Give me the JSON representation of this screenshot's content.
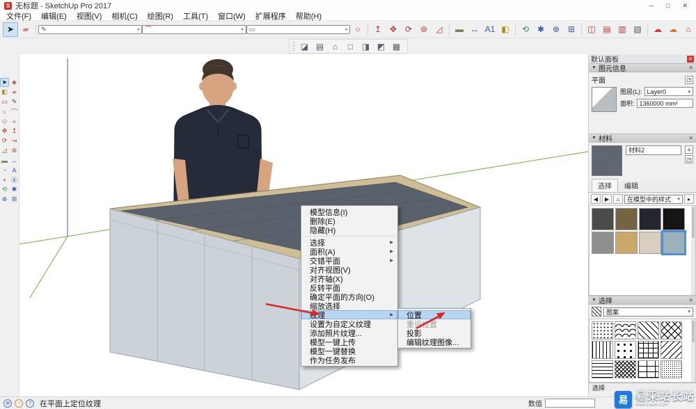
{
  "window": {
    "title": "无标题 - SketchUp Pro 2017",
    "app_icon": "S",
    "controls": [
      {
        "name": "minimize-button",
        "glyph": "─"
      },
      {
        "name": "maximize-button",
        "glyph": "□"
      },
      {
        "name": "close-button",
        "glyph": "✕"
      }
    ]
  },
  "menu_bar": {
    "items": [
      {
        "name": "menu-file",
        "label": "文件(F)"
      },
      {
        "name": "menu-edit",
        "label": "编辑(E)"
      },
      {
        "name": "menu-view",
        "label": "视图(V)"
      },
      {
        "name": "menu-camera",
        "label": "相机(C)"
      },
      {
        "name": "menu-draw",
        "label": "绘图(R)"
      },
      {
        "name": "menu-tools",
        "label": "工具(T)"
      },
      {
        "name": "menu-window",
        "label": "窗口(W)"
      },
      {
        "name": "menu-extensions",
        "label": "扩展程序"
      },
      {
        "name": "menu-help",
        "label": "帮助(H)"
      }
    ]
  },
  "toolbar_main": {
    "icons": [
      {
        "name": "select-tool-icon",
        "glyph": "➤",
        "color": "#1a1a1a",
        "active": true
      },
      {
        "name": "eraser-tool-icon",
        "glyph": "▰",
        "color": "#d4848f"
      },
      {
        "separator": true
      },
      {
        "name": "line-tool-icon",
        "glyph": "✎",
        "color": "#444444",
        "dropdown": true
      },
      {
        "name": "arc-tool-icon",
        "glyph": "⌒",
        "color": "#b03a2e",
        "dropdown": true
      },
      {
        "name": "rectangle-tool-icon",
        "glyph": "▭",
        "color": "#b03a2e",
        "dropdown": true
      },
      {
        "name": "circle-tool-icon",
        "glyph": "○",
        "color": "#b03a2e"
      },
      {
        "separator": true
      },
      {
        "name": "push-pull-tool-icon",
        "glyph": "↥",
        "color": "#b03a2e"
      },
      {
        "name": "move-tool-icon",
        "glyph": "✥",
        "color": "#b03a2e"
      },
      {
        "name": "rotate-tool-icon",
        "glyph": "⟳",
        "color": "#b03a2e"
      },
      {
        "name": "offset-tool-icon",
        "glyph": "⊚",
        "color": "#b03a2e"
      },
      {
        "name": "scale-tool-icon",
        "glyph": "◿",
        "color": "#b03a2e"
      },
      {
        "separator": true
      },
      {
        "name": "tape-measure-tool-icon",
        "glyph": "▬",
        "color": "#8a7a50"
      },
      {
        "name": "dimension-tool-icon",
        "glyph": "↔",
        "color": "#2e5fb0"
      },
      {
        "name": "text-tool-icon",
        "glyph": "A1",
        "color": "#2e5fb0"
      },
      {
        "name": "paint-bucket-tool-icon",
        "glyph": "◧",
        "color": "#b08a1e"
      },
      {
        "separator": true
      },
      {
        "name": "orbit-tool-icon",
        "glyph": "⟲",
        "color": "#2e8f4e"
      },
      {
        "name": "pan-tool-icon",
        "glyph": "✱",
        "color": "#2e5fb0"
      },
      {
        "name": "zoom-tool-icon",
        "glyph": "⊕",
        "color": "#2e5fb0"
      },
      {
        "name": "zoom-extents-tool-icon",
        "glyph": "⊞",
        "color": "#2e5fb0"
      },
      {
        "separator": true
      },
      {
        "name": "section-plane-tool-icon",
        "glyph": "◫",
        "color": "#b03a2e"
      },
      {
        "name": "section-fill-tool-icon",
        "glyph": "▤",
        "color": "#b03a2e"
      },
      {
        "name": "section-display-tool-icon",
        "glyph": "▥",
        "color": "#b03a2e"
      },
      {
        "name": "match-photo-tool-icon",
        "glyph": "▧",
        "color": "#555555"
      },
      {
        "separator": true
      },
      {
        "name": "cloud-upload-tool-icon",
        "glyph": "☁",
        "color": "#d23b2f"
      },
      {
        "name": "cloud-library-tool-icon",
        "glyph": "☁",
        "color": "#e2703a"
      },
      {
        "name": "model-warehouse-tool-icon",
        "glyph": "⌂",
        "color": "#d23b2f"
      }
    ]
  },
  "toolbar_views": {
    "icons": [
      {
        "name": "iso-view-icon",
        "glyph": "◪",
        "color": "#55616e"
      },
      {
        "name": "top-view-icon",
        "glyph": "▤",
        "color": "#55616e"
      },
      {
        "name": "home-view-icon",
        "glyph": "⌂",
        "color": "#8a5a2e"
      },
      {
        "name": "front-view-icon",
        "glyph": "□",
        "color": "#55616e"
      },
      {
        "name": "right-view-icon",
        "glyph": "◨",
        "color": "#55616e"
      },
      {
        "name": "back-view-icon",
        "glyph": "◩",
        "color": "#55616e"
      },
      {
        "name": "print-icon",
        "glyph": "▦",
        "color": "#55616e"
      }
    ]
  },
  "toolbar_left": {
    "icons": [
      {
        "name": "lt-select-tool-icon",
        "glyph": "➤",
        "color": "#151515",
        "active": true
      },
      {
        "name": "lt-make-component-icon",
        "glyph": "◈",
        "color": "#b03a2e"
      },
      {
        "name": "lt-paint-bucket-icon",
        "glyph": "◧",
        "color": "#b08a1e"
      },
      {
        "name": "lt-eraser-tool-icon",
        "glyph": "▰",
        "color": "#d4848f"
      },
      {
        "name": "lt-rectangle-tool-icon",
        "glyph": "▭",
        "color": "#b03a2e"
      },
      {
        "name": "lt-line-tool-icon",
        "glyph": "✎",
        "color": "#444444"
      },
      {
        "name": "lt-circle-tool-icon",
        "glyph": "○",
        "color": "#b03a2e"
      },
      {
        "name": "lt-arc-tool-icon",
        "glyph": "⌒",
        "color": "#b03a2e"
      },
      {
        "name": "lt-polygon-tool-icon",
        "glyph": "◇",
        "color": "#b03a2e"
      },
      {
        "name": "lt-freehand-tool-icon",
        "glyph": "≈",
        "color": "#b03a2e"
      },
      {
        "name": "lt-move-tool-icon",
        "glyph": "✥",
        "color": "#b03a2e"
      },
      {
        "name": "lt-push-pull-tool-icon",
        "glyph": "↥",
        "color": "#b03a2e"
      },
      {
        "name": "lt-rotate-tool-icon",
        "glyph": "⟳",
        "color": "#b03a2e"
      },
      {
        "name": "lt-follow-me-tool-icon",
        "glyph": "↝",
        "color": "#b03a2e"
      },
      {
        "name": "lt-scale-tool-icon",
        "glyph": "◿",
        "color": "#b03a2e"
      },
      {
        "name": "lt-offset-tool-icon",
        "glyph": "⊚",
        "color": "#b03a2e"
      },
      {
        "name": "lt-tape-measure-icon",
        "glyph": "▬",
        "color": "#8a7a50"
      },
      {
        "name": "lt-dimension-tool-icon",
        "glyph": "↔",
        "color": "#2e5fb0"
      },
      {
        "name": "lt-protractor-tool-icon",
        "glyph": "◔",
        "color": "#8a7a50"
      },
      {
        "name": "lt-text-tool-icon",
        "glyph": "A",
        "color": "#2e5fb0"
      },
      {
        "name": "lt-axes-tool-icon",
        "glyph": "+",
        "color": "#b03a2e"
      },
      {
        "name": "lt-3d-text-tool-icon",
        "glyph": "Ⓐ",
        "color": "#2e5fb0"
      },
      {
        "name": "lt-orbit-tool-icon",
        "glyph": "⟲",
        "color": "#2e8f4e"
      },
      {
        "name": "lt-pan-tool-icon",
        "glyph": "✱",
        "color": "#2e5fb0"
      },
      {
        "name": "lt-zoom-tool-icon",
        "glyph": "⊕",
        "color": "#2e5fb0"
      },
      {
        "name": "lt-zoom-extents-icon",
        "glyph": "⊞",
        "color": "#2e5fb0"
      }
    ]
  },
  "context_menu": {
    "items": [
      {
        "name": "cm-model-info",
        "label": "模型信息(I)"
      },
      {
        "name": "cm-delete",
        "label": "删除(E)"
      },
      {
        "name": "cm-hide",
        "label": "隐藏(H)"
      },
      {
        "name": "cm-separator-1",
        "separator": true
      },
      {
        "name": "cm-select",
        "label": "选择",
        "submenu": true
      },
      {
        "name": "cm-area",
        "label": "面积(A)",
        "submenu": true
      },
      {
        "name": "cm-intersect-faces",
        "label": "交错平面",
        "submenu": true
      },
      {
        "name": "cm-align-view",
        "label": "对齐视图(V)"
      },
      {
        "name": "cm-align-axes",
        "label": "对齐轴(X)"
      },
      {
        "name": "cm-reverse-faces",
        "label": "反转平面"
      },
      {
        "name": "cm-orient-faces",
        "label": "确定平面的方向(O)"
      },
      {
        "name": "cm-zoom-selection",
        "label": "缩放选择"
      },
      {
        "name": "cm-texture",
        "label": "纹理",
        "submenu": true,
        "highlighted": true
      },
      {
        "name": "cm-make-unique-texture",
        "label": "设置为自定义纹理"
      },
      {
        "name": "cm-add-photo-texture",
        "label": "添加照片纹理..."
      },
      {
        "name": "cm-model-upload",
        "label": "模型一键上传"
      },
      {
        "name": "cm-model-replace",
        "label": "模型一键替换"
      },
      {
        "name": "cm-publish-task",
        "label": "作为任务发布"
      }
    ]
  },
  "texture_submenu": {
    "items": [
      {
        "name": "sm-position",
        "label": "位置",
        "highlighted": true
      },
      {
        "name": "sm-reset-position",
        "label": "重设位置",
        "disabled": true
      },
      {
        "name": "sm-projected",
        "label": "投影"
      },
      {
        "name": "sm-edit-texture-image",
        "label": "编辑纹理图像..."
      }
    ]
  },
  "right_panel": {
    "tray_title": "默认面板",
    "entity_info": {
      "title": "图元信息",
      "type": "平面",
      "layer_label": "图层(L):",
      "layer_value": "Layer0",
      "area_label": "面积:",
      "area_value": "1360000 mm²"
    },
    "materials": {
      "title": "材料",
      "name": "材料2",
      "tab_select": "选择",
      "tab_edit": "编辑",
      "style_dropdown": "在模型中的样式",
      "swatches": [
        {
          "name": "material-swatch-charcoal",
          "bg": "#4b4b49"
        },
        {
          "name": "material-swatch-olive",
          "bg": "#756442"
        },
        {
          "name": "material-swatch-navy",
          "bg": "#23262e"
        },
        {
          "name": "material-swatch-black",
          "bg": "#151515"
        },
        {
          "name": "material-swatch-gray",
          "bg": "#8f8f8d"
        },
        {
          "name": "material-swatch-tan",
          "bg": "#c9a86a"
        },
        {
          "name": "material-swatch-beige",
          "bg": "#d8cfc0"
        },
        {
          "name": "material-swatch-bluegray",
          "bg": "#9fb0bd",
          "highlighted": true
        }
      ]
    },
    "styles": {
      "title": "选择",
      "dropdown": "图案",
      "patterns": [
        {
          "name": "pattern-dots-small",
          "pattern": "dots-sm"
        },
        {
          "name": "pattern-shingles",
          "pattern": "shingle"
        },
        {
          "name": "pattern-diagonal-hatch",
          "pattern": "diag"
        },
        {
          "name": "pattern-crosshatch",
          "pattern": "cross"
        },
        {
          "name": "pattern-vertical-lines",
          "pattern": "vlines"
        },
        {
          "name": "pattern-dots-large",
          "pattern": "dots-lg"
        },
        {
          "name": "pattern-grid",
          "pattern": "grid"
        },
        {
          "name": "pattern-diagonal-left",
          "pattern": "diag-l"
        },
        {
          "name": "pattern-horizontal-lines",
          "pattern": "hlines"
        },
        {
          "name": "pattern-zigzag",
          "pattern": "zig"
        },
        {
          "name": "pattern-brick",
          "pattern": "brick"
        },
        {
          "name": "pattern-dense-dots",
          "pattern": "dots-dense"
        }
      ]
    },
    "select_footer": "选择"
  },
  "status_bar": {
    "icons": [
      {
        "name": "geolocation-icon",
        "glyph": "⊕",
        "color": "#4a79c4"
      },
      {
        "name": "claim-credit-icon",
        "glyph": "◔",
        "color": "#d08a3a"
      },
      {
        "name": "help-icon",
        "glyph": "?",
        "color": "#4a79c4"
      }
    ],
    "hint": "在平面上定位纹理",
    "measure_label": "数值"
  },
  "watermark": {
    "icon_text": "易",
    "brand": "易采站长站",
    "sub": "Www.Easck.Com"
  },
  "colors": {
    "menu_highlight": "#b8d6f2",
    "axis_green": "#6fae3f",
    "axis_blue": "#3c5bd6",
    "accent_red": "#e02424"
  }
}
